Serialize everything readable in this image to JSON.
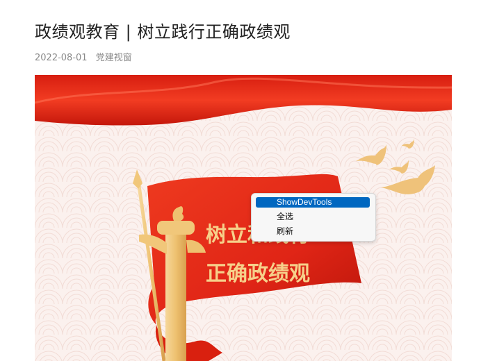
{
  "article": {
    "title": "政绩观教育 | 树立践行正确政绩观",
    "date": "2022-08-01",
    "author": "党建视窗"
  },
  "banner": {
    "line1": "树立和践行",
    "line2": "正确政绩观"
  },
  "context_menu": {
    "items": [
      {
        "label": "ShowDevTools",
        "highlighted": true
      },
      {
        "label": "全选",
        "highlighted": false
      },
      {
        "label": "刷新",
        "highlighted": false
      }
    ]
  },
  "colors": {
    "flag_red": "#e02516",
    "gold": "#f1c77a",
    "menu_highlight": "#0067c0",
    "background_pattern": "#fbf1ee"
  }
}
